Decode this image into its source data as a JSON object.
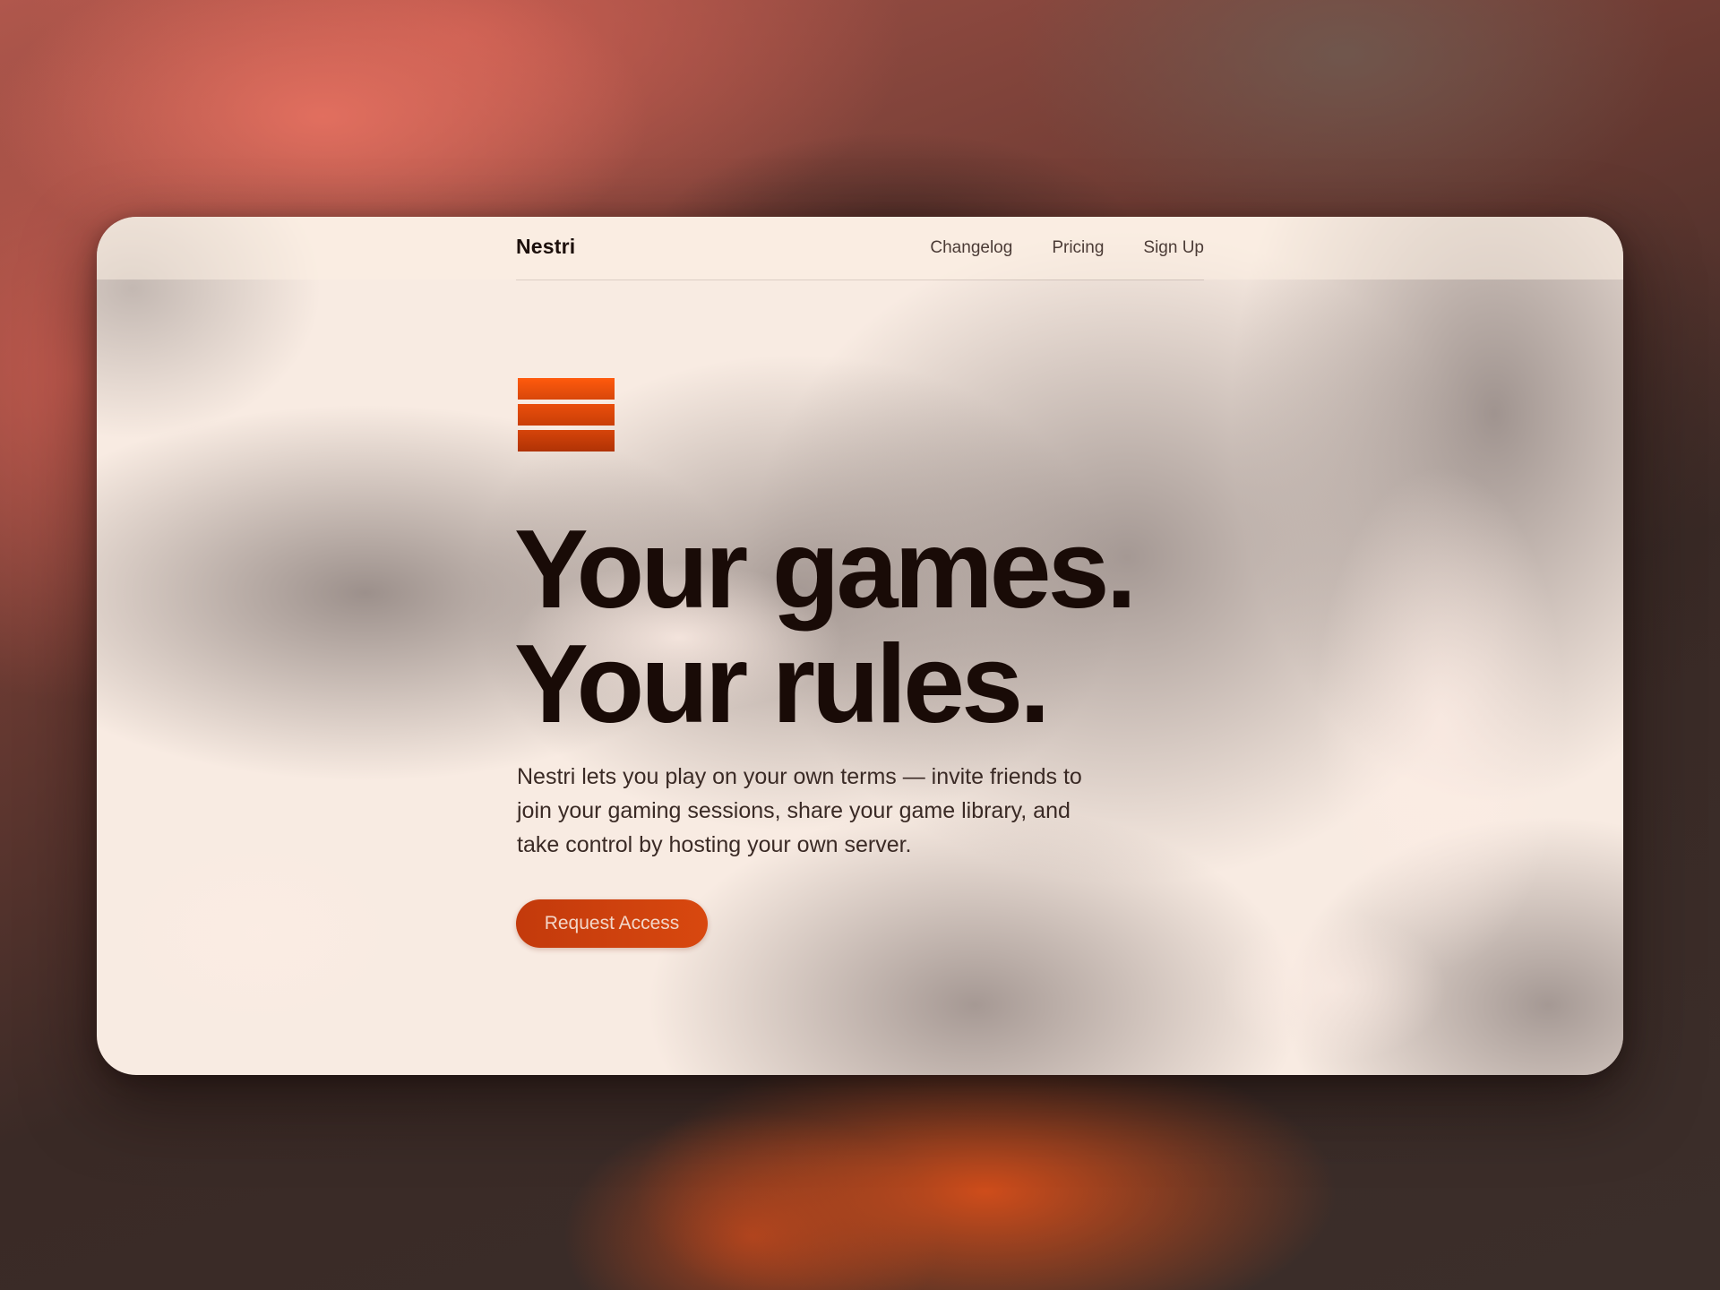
{
  "nav": {
    "brand": "Nestri",
    "links": [
      "Changelog",
      "Pricing",
      "Sign Up"
    ]
  },
  "logo": {
    "icon": "three-bars-logo-icon",
    "colors": [
      "#ff5a0d",
      "#e24709",
      "#c23a06"
    ]
  },
  "hero": {
    "headline_line1": "Your games.",
    "headline_line2": "Your rules.",
    "description": "Nestri lets you play on your own terms — invite friends to join your gaming sessions, share your game library, and take control by hosting your own server.",
    "cta_label": "Request Access"
  },
  "colors": {
    "accent": "#d8480f",
    "text_dark": "#190b07",
    "card_bg": "#f8ebe2"
  }
}
